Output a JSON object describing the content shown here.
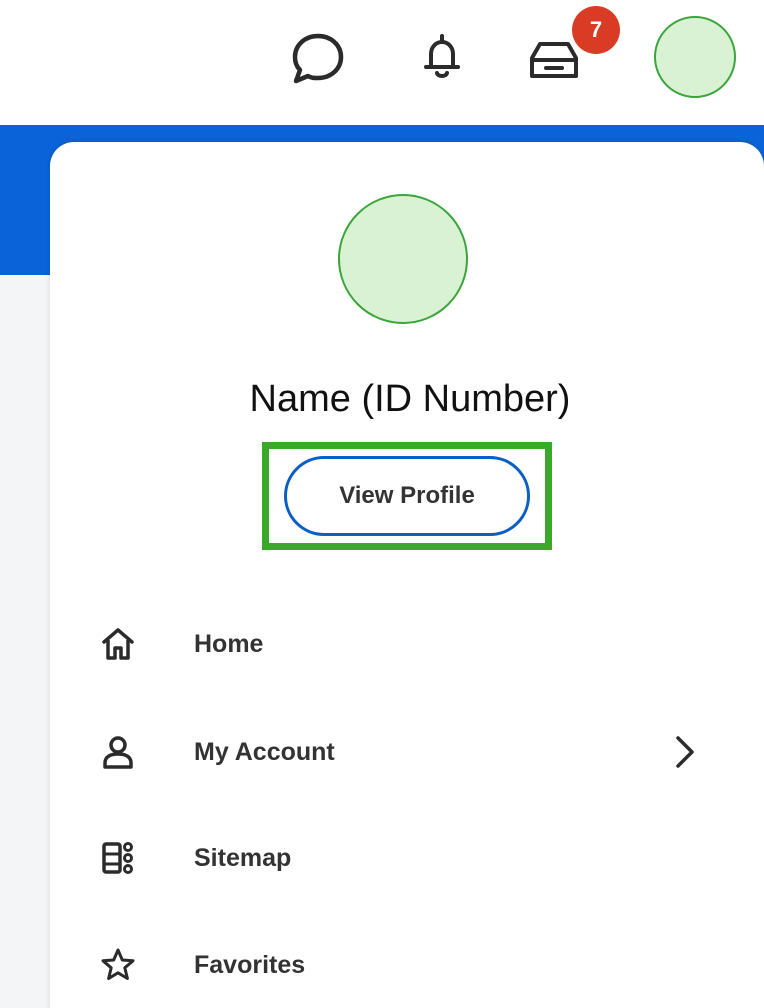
{
  "topbar": {
    "chat_icon": "chat-bubble-icon",
    "notifications_icon": "bell-icon",
    "inbox_icon": "inbox-icon",
    "inbox_badge_count": "7"
  },
  "profile": {
    "name": "Name (ID Number)",
    "view_profile_label": "View Profile"
  },
  "menu": {
    "items": [
      {
        "label": "Home",
        "icon": "home-icon"
      },
      {
        "label": "My Account",
        "icon": "person-icon",
        "has_submenu": true
      },
      {
        "label": "Sitemap",
        "icon": "sitemap-icon"
      },
      {
        "label": "Favorites",
        "icon": "star-icon"
      }
    ]
  },
  "colors": {
    "brand_blue": "#0a63d8",
    "badge_red": "#d93b25",
    "highlight_green": "#3aa829",
    "avatar_fill": "#d9f2d4"
  }
}
